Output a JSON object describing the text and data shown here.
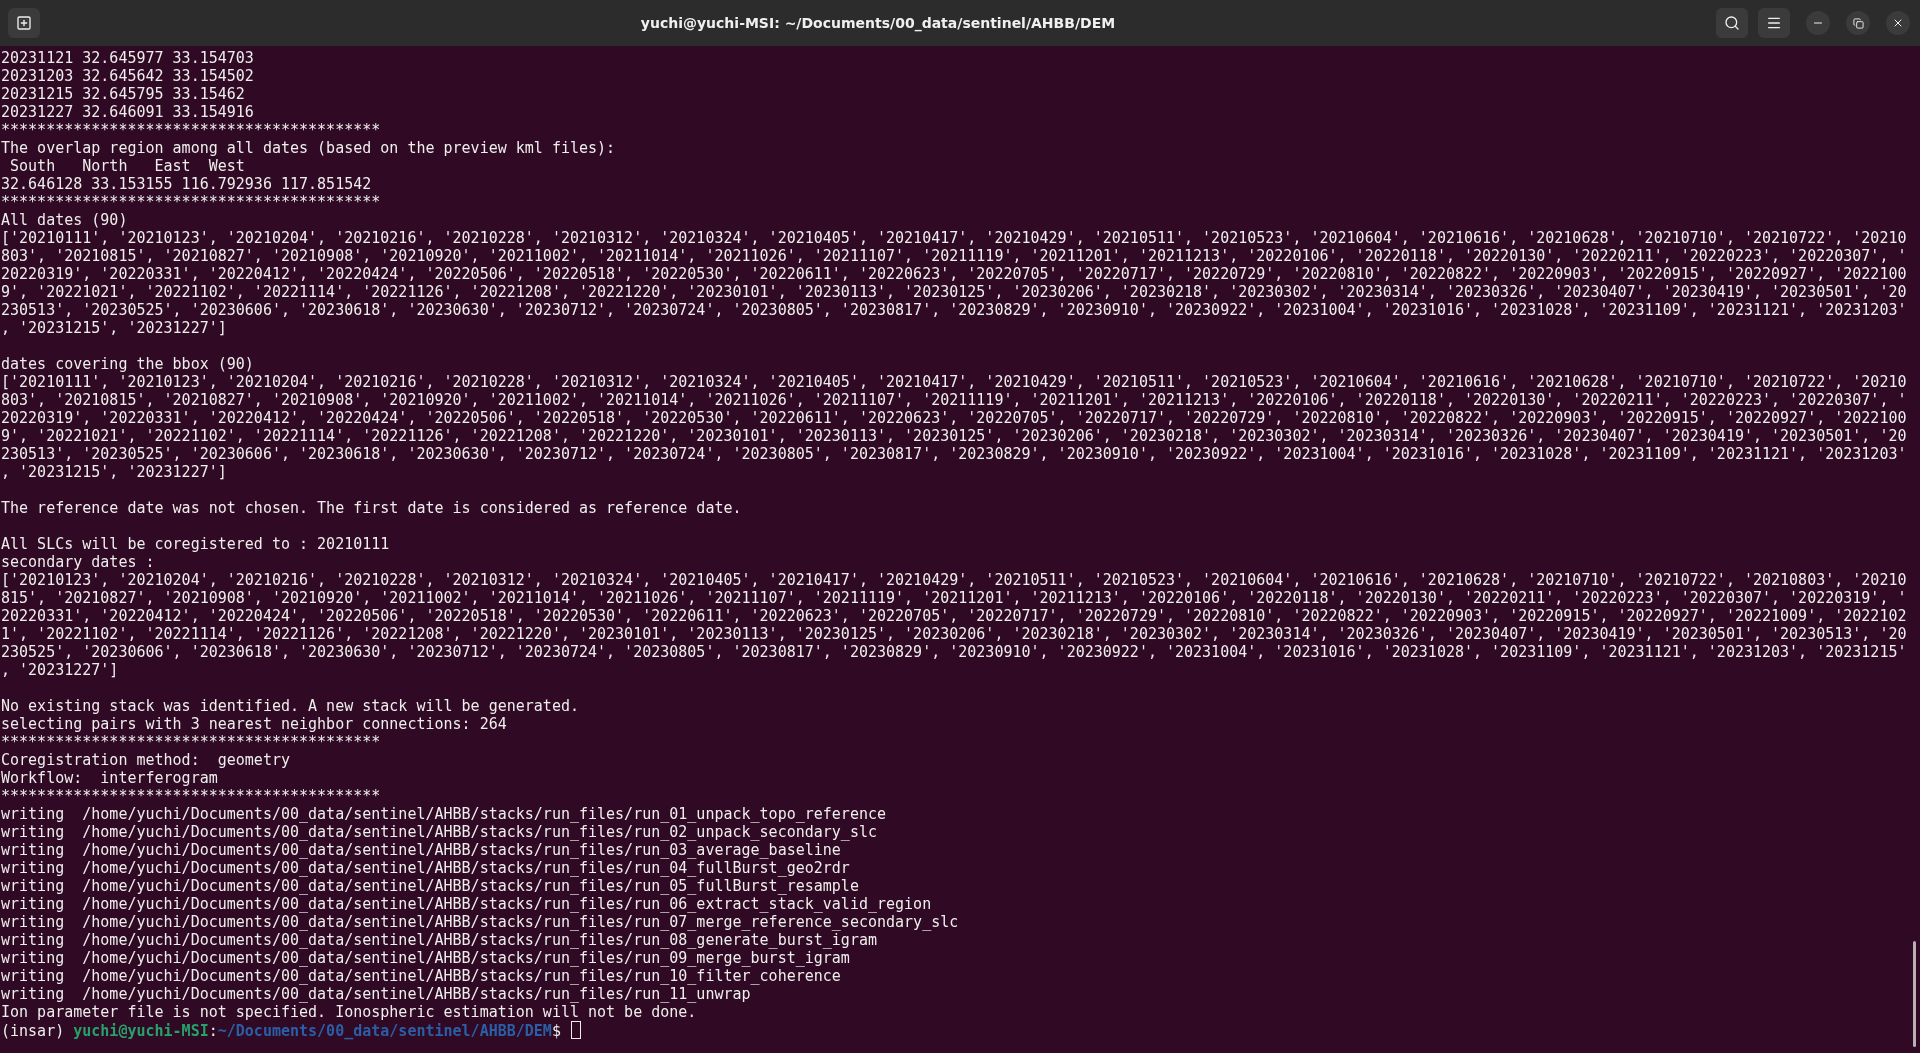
{
  "window": {
    "title": "yuchi@yuchi-MSI: ~/Documents/00_data/sentinel/AHBB/DEM"
  },
  "terminal": {
    "lines": [
      {
        "kind": "text",
        "text": "20231121 32.645977 33.154703"
      },
      {
        "kind": "text",
        "text": "20231203 32.645642 33.154502"
      },
      {
        "kind": "text",
        "text": "20231215 32.645795 33.15462"
      },
      {
        "kind": "text",
        "text": "20231227 32.646091 33.154916"
      },
      {
        "kind": "text",
        "text": "******************************************"
      },
      {
        "kind": "text",
        "text": "The overlap region among all dates (based on the preview kml files):"
      },
      {
        "kind": "text",
        "text": " South   North   East  West"
      },
      {
        "kind": "text",
        "text": "32.646128 33.153155 116.792936 117.851542"
      },
      {
        "kind": "text",
        "text": "******************************************"
      },
      {
        "kind": "text",
        "text": "All dates (90)"
      },
      {
        "kind": "text",
        "text": "['20210111', '20210123', '20210204', '20210216', '20210228', '20210312', '20210324', '20210405', '20210417', '20210429', '20210511', '20210523', '20210604', '20210616', '20210628', '20210710', '20210722', '20210"
      },
      {
        "kind": "text",
        "text": "803', '20210815', '20210827', '20210908', '20210920', '20211002', '20211014', '20211026', '20211107', '20211119', '20211201', '20211213', '20220106', '20220118', '20220130', '20220211', '20220223', '20220307', '"
      },
      {
        "kind": "text",
        "text": "20220319', '20220331', '20220412', '20220424', '20220506', '20220518', '20220530', '20220611', '20220623', '20220705', '20220717', '20220729', '20220810', '20220822', '20220903', '20220915', '20220927', '2022100"
      },
      {
        "kind": "text",
        "text": "9', '20221021', '20221102', '20221114', '20221126', '20221208', '20221220', '20230101', '20230113', '20230125', '20230206', '20230218', '20230302', '20230314', '20230326', '20230407', '20230419', '20230501', '20"
      },
      {
        "kind": "text",
        "text": "230513', '20230525', '20230606', '20230618', '20230630', '20230712', '20230724', '20230805', '20230817', '20230829', '20230910', '20230922', '20231004', '20231016', '20231028', '20231109', '20231121', '20231203'"
      },
      {
        "kind": "text",
        "text": ", '20231215', '20231227']"
      },
      {
        "kind": "blank"
      },
      {
        "kind": "text",
        "text": "dates covering the bbox (90)"
      },
      {
        "kind": "text",
        "text": "['20210111', '20210123', '20210204', '20210216', '20210228', '20210312', '20210324', '20210405', '20210417', '20210429', '20210511', '20210523', '20210604', '20210616', '20210628', '20210710', '20210722', '20210"
      },
      {
        "kind": "text",
        "text": "803', '20210815', '20210827', '20210908', '20210920', '20211002', '20211014', '20211026', '20211107', '20211119', '20211201', '20211213', '20220106', '20220118', '20220130', '20220211', '20220223', '20220307', '"
      },
      {
        "kind": "text",
        "text": "20220319', '20220331', '20220412', '20220424', '20220506', '20220518', '20220530', '20220611', '20220623', '20220705', '20220717', '20220729', '20220810', '20220822', '20220903', '20220915', '20220927', '2022100"
      },
      {
        "kind": "text",
        "text": "9', '20221021', '20221102', '20221114', '20221126', '20221208', '20221220', '20230101', '20230113', '20230125', '20230206', '20230218', '20230302', '20230314', '20230326', '20230407', '20230419', '20230501', '20"
      },
      {
        "kind": "text",
        "text": "230513', '20230525', '20230606', '20230618', '20230630', '20230712', '20230724', '20230805', '20230817', '20230829', '20230910', '20230922', '20231004', '20231016', '20231028', '20231109', '20231121', '20231203'"
      },
      {
        "kind": "text",
        "text": ", '20231215', '20231227']"
      },
      {
        "kind": "blank"
      },
      {
        "kind": "text",
        "text": "The reference date was not chosen. The first date is considered as reference date."
      },
      {
        "kind": "blank"
      },
      {
        "kind": "text",
        "text": "All SLCs will be coregistered to : 20210111"
      },
      {
        "kind": "text",
        "text": "secondary dates :"
      },
      {
        "kind": "text",
        "text": "['20210123', '20210204', '20210216', '20210228', '20210312', '20210324', '20210405', '20210417', '20210429', '20210511', '20210523', '20210604', '20210616', '20210628', '20210710', '20210722', '20210803', '20210"
      },
      {
        "kind": "text",
        "text": "815', '20210827', '20210908', '20210920', '20211002', '20211014', '20211026', '20211107', '20211119', '20211201', '20211213', '20220106', '20220118', '20220130', '20220211', '20220223', '20220307', '20220319', '"
      },
      {
        "kind": "text",
        "text": "20220331', '20220412', '20220424', '20220506', '20220518', '20220530', '20220611', '20220623', '20220705', '20220717', '20220729', '20220810', '20220822', '20220903', '20220915', '20220927', '20221009', '2022102"
      },
      {
        "kind": "text",
        "text": "1', '20221102', '20221114', '20221126', '20221208', '20221220', '20230101', '20230113', '20230125', '20230206', '20230218', '20230302', '20230314', '20230326', '20230407', '20230419', '20230501', '20230513', '20"
      },
      {
        "kind": "text",
        "text": "230525', '20230606', '20230618', '20230630', '20230712', '20230724', '20230805', '20230817', '20230829', '20230910', '20230922', '20231004', '20231016', '20231028', '20231109', '20231121', '20231203', '20231215'"
      },
      {
        "kind": "text",
        "text": ", '20231227']"
      },
      {
        "kind": "blank"
      },
      {
        "kind": "text",
        "text": "No existing stack was identified. A new stack will be generated."
      },
      {
        "kind": "text",
        "text": "selecting pairs with 3 nearest neighbor connections: 264"
      },
      {
        "kind": "text",
        "text": "******************************************"
      },
      {
        "kind": "text",
        "text": "Coregistration method:  geometry"
      },
      {
        "kind": "text",
        "text": "Workflow:  interferogram"
      },
      {
        "kind": "text",
        "text": "******************************************"
      },
      {
        "kind": "text",
        "text": "writing  /home/yuchi/Documents/00_data/sentinel/AHBB/stacks/run_files/run_01_unpack_topo_reference"
      },
      {
        "kind": "text",
        "text": "writing  /home/yuchi/Documents/00_data/sentinel/AHBB/stacks/run_files/run_02_unpack_secondary_slc"
      },
      {
        "kind": "text",
        "text": "writing  /home/yuchi/Documents/00_data/sentinel/AHBB/stacks/run_files/run_03_average_baseline"
      },
      {
        "kind": "text",
        "text": "writing  /home/yuchi/Documents/00_data/sentinel/AHBB/stacks/run_files/run_04_fullBurst_geo2rdr"
      },
      {
        "kind": "text",
        "text": "writing  /home/yuchi/Documents/00_data/sentinel/AHBB/stacks/run_files/run_05_fullBurst_resample"
      },
      {
        "kind": "text",
        "text": "writing  /home/yuchi/Documents/00_data/sentinel/AHBB/stacks/run_files/run_06_extract_stack_valid_region"
      },
      {
        "kind": "text",
        "text": "writing  /home/yuchi/Documents/00_data/sentinel/AHBB/stacks/run_files/run_07_merge_reference_secondary_slc"
      },
      {
        "kind": "text",
        "text": "writing  /home/yuchi/Documents/00_data/sentinel/AHBB/stacks/run_files/run_08_generate_burst_igram"
      },
      {
        "kind": "text",
        "text": "writing  /home/yuchi/Documents/00_data/sentinel/AHBB/stacks/run_files/run_09_merge_burst_igram"
      },
      {
        "kind": "text",
        "text": "writing  /home/yuchi/Documents/00_data/sentinel/AHBB/stacks/run_files/run_10_filter_coherence"
      },
      {
        "kind": "text",
        "text": "writing  /home/yuchi/Documents/00_data/sentinel/AHBB/stacks/run_files/run_11_unwrap"
      },
      {
        "kind": "text",
        "text": "Ion parameter file is not specified. Ionospheric estimation will not be done."
      },
      {
        "kind": "prompt",
        "env": "(insar)",
        "user_host": "yuchi@yuchi-MSI",
        "separator": ":",
        "path": "~/Documents/00_data/sentinel/AHBB/DEM",
        "symbol": "$"
      }
    ]
  }
}
